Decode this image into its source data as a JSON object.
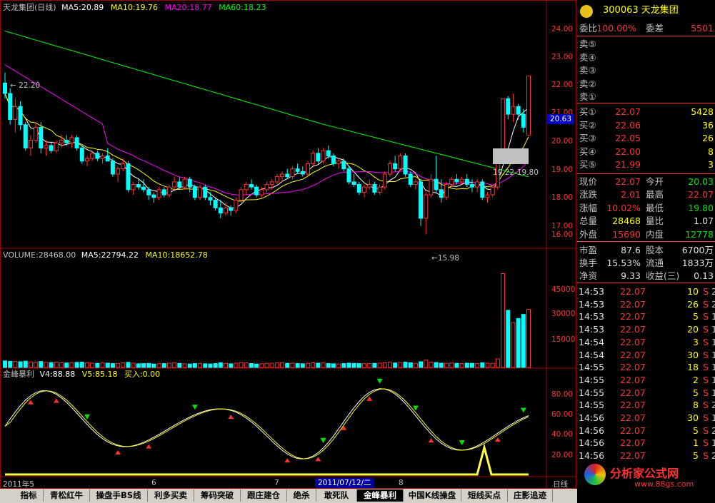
{
  "header_main": {
    "name": "天龙集团(日线)",
    "ma5": "MA5:20.89",
    "ma10": "MA10:19.76",
    "ma20": "MA20:18.77",
    "ma60": "MA60:18.23"
  },
  "header_volume": {
    "volume": "VOLUME:28468.00",
    "ma5": "MA5:22794.22",
    "ma10": "MA10:18652.78"
  },
  "header_indicator": {
    "name": "金峰暴利",
    "v4": "V4:88.88",
    "v5": "V5:85.18",
    "buy": "买入:0.00"
  },
  "price_axis": [
    "24.00",
    "23.00",
    "22.00",
    "21.00",
    "20.00",
    "19.00",
    "18.00",
    "17.00",
    "16.00"
  ],
  "current_price_tag": "20.63",
  "volume_axis": [
    "45000",
    "30000",
    "15000"
  ],
  "indicator_axis": [
    "80.00",
    "60.00",
    "40.00",
    "20.00"
  ],
  "annotations": {
    "high_left": "22.20",
    "low": "15.98",
    "range": "19.22-19.80"
  },
  "date_labels": [
    "2011年5",
    "6",
    "7",
    "8"
  ],
  "cursor_date": "2011/07/12/二",
  "period_label": "日线",
  "chart_data": {
    "type": "candlestick",
    "ylim": [
      15.5,
      24.5
    ],
    "series": [
      {
        "name": "MA5",
        "color": "#ffffff"
      },
      {
        "name": "MA10",
        "color": "#ffff00"
      },
      {
        "name": "MA20",
        "color": "#ff00ff"
      },
      {
        "name": "MA60",
        "color": "#00ff00"
      }
    ],
    "candles": [
      [
        21.8,
        22.2,
        21.2,
        21.4
      ],
      [
        21.4,
        21.6,
        20.2,
        20.4
      ],
      [
        20.4,
        21.2,
        19.9,
        20.9
      ],
      [
        20.9,
        21.1,
        20.0,
        20.2
      ],
      [
        20.2,
        20.3,
        19.2,
        19.3
      ],
      [
        19.3,
        19.8,
        19.0,
        19.6
      ],
      [
        19.6,
        20.3,
        19.5,
        20.1
      ],
      [
        20.1,
        20.3,
        19.1,
        19.3
      ],
      [
        19.3,
        19.6,
        19.0,
        19.4
      ],
      [
        19.4,
        19.5,
        19.1,
        19.2
      ],
      [
        19.2,
        19.6,
        19.1,
        19.5
      ],
      [
        19.5,
        19.8,
        19.3,
        19.6
      ],
      [
        19.6,
        19.8,
        19.4,
        19.5
      ],
      [
        19.5,
        19.8,
        19.3,
        19.7
      ],
      [
        19.7,
        19.8,
        19.2,
        19.3
      ],
      [
        19.3,
        19.4,
        18.7,
        18.8
      ],
      [
        18.8,
        19.0,
        18.6,
        18.9
      ],
      [
        18.9,
        19.2,
        18.8,
        19.1
      ],
      [
        19.1,
        19.2,
        18.8,
        18.9
      ],
      [
        18.9,
        19.1,
        18.7,
        19.0
      ],
      [
        19.0,
        19.3,
        18.8,
        18.8
      ],
      [
        18.8,
        18.9,
        18.2,
        18.3
      ],
      [
        18.3,
        18.6,
        18.0,
        18.5
      ],
      [
        18.5,
        18.9,
        18.4,
        18.7
      ],
      [
        18.7,
        18.8,
        17.6,
        17.7
      ],
      [
        17.7,
        18.0,
        17.5,
        17.9
      ],
      [
        17.9,
        18.1,
        17.7,
        17.8
      ],
      [
        17.8,
        18.1,
        17.6,
        17.7
      ],
      [
        17.7,
        17.8,
        17.3,
        17.5
      ],
      [
        17.5,
        17.6,
        17.2,
        17.4
      ],
      [
        17.4,
        17.8,
        17.3,
        17.7
      ],
      [
        17.7,
        17.8,
        17.4,
        17.5
      ],
      [
        17.5,
        17.9,
        17.4,
        17.8
      ],
      [
        17.8,
        18.2,
        17.7,
        18.0
      ],
      [
        18.0,
        18.2,
        17.7,
        17.8
      ],
      [
        17.8,
        18.2,
        17.7,
        18.1
      ],
      [
        18.1,
        18.2,
        17.6,
        17.8
      ],
      [
        17.8,
        17.9,
        17.3,
        17.4
      ],
      [
        17.4,
        17.9,
        17.3,
        17.8
      ],
      [
        17.8,
        17.9,
        17.3,
        17.4
      ],
      [
        17.4,
        17.6,
        17.1,
        17.3
      ],
      [
        17.3,
        17.4,
        16.9,
        17.0
      ],
      [
        17.0,
        17.3,
        16.6,
        16.8
      ],
      [
        16.8,
        17.2,
        16.7,
        17.0
      ],
      [
        17.0,
        17.1,
        16.7,
        16.9
      ],
      [
        16.9,
        17.4,
        16.8,
        17.3
      ],
      [
        17.3,
        17.8,
        17.2,
        17.7
      ],
      [
        17.7,
        18.0,
        17.5,
        17.9
      ],
      [
        17.9,
        18.1,
        17.7,
        17.8
      ],
      [
        17.8,
        17.9,
        17.4,
        17.5
      ],
      [
        17.5,
        17.8,
        17.4,
        17.7
      ],
      [
        17.7,
        18.0,
        17.6,
        17.9
      ],
      [
        17.9,
        18.1,
        17.7,
        18.0
      ],
      [
        18.0,
        18.3,
        17.9,
        18.2
      ],
      [
        18.2,
        18.4,
        18.0,
        18.3
      ],
      [
        18.3,
        18.5,
        18.1,
        18.2
      ],
      [
        18.2,
        18.6,
        18.1,
        18.5
      ],
      [
        18.5,
        18.7,
        18.3,
        18.4
      ],
      [
        18.4,
        18.6,
        18.2,
        18.3
      ],
      [
        18.3,
        18.8,
        18.2,
        18.7
      ],
      [
        18.7,
        19.2,
        18.6,
        19.1
      ],
      [
        19.1,
        19.3,
        18.7,
        18.8
      ],
      [
        18.8,
        19.3,
        18.7,
        19.2
      ],
      [
        19.2,
        19.4,
        18.9,
        19.0
      ],
      [
        19.0,
        19.1,
        18.6,
        18.7
      ],
      [
        18.7,
        18.9,
        18.5,
        18.8
      ],
      [
        18.8,
        18.9,
        18.4,
        18.5
      ],
      [
        18.5,
        18.6,
        17.9,
        18.0
      ],
      [
        18.0,
        18.3,
        17.8,
        17.9
      ],
      [
        17.9,
        18.0,
        17.5,
        17.6
      ],
      [
        17.6,
        17.9,
        17.4,
        17.8
      ],
      [
        17.8,
        18.1,
        17.7,
        17.9
      ],
      [
        17.9,
        18.0,
        17.5,
        17.6
      ],
      [
        17.6,
        17.9,
        17.5,
        17.8
      ],
      [
        17.8,
        18.4,
        17.7,
        18.3
      ],
      [
        18.3,
        18.8,
        18.2,
        18.7
      ],
      [
        18.7,
        19.0,
        18.4,
        18.5
      ],
      [
        18.5,
        19.1,
        18.4,
        19.0
      ],
      [
        19.0,
        19.1,
        18.2,
        18.3
      ],
      [
        18.3,
        18.4,
        17.8,
        17.9
      ],
      [
        17.9,
        18.1,
        17.7,
        18.0
      ],
      [
        18.0,
        18.1,
        16.3,
        16.6
      ],
      [
        16.6,
        17.6,
        15.98,
        17.5
      ],
      [
        17.5,
        18.3,
        17.4,
        18.1
      ],
      [
        18.1,
        19.0,
        17.6,
        17.7
      ],
      [
        17.7,
        18.1,
        17.2,
        17.4
      ],
      [
        17.4,
        18.0,
        17.3,
        17.9
      ],
      [
        17.9,
        18.2,
        17.8,
        18.1
      ],
      [
        18.1,
        18.3,
        17.9,
        18.0
      ],
      [
        18.0,
        18.2,
        17.9,
        18.1
      ],
      [
        18.1,
        18.3,
        17.8,
        17.9
      ],
      [
        17.9,
        18.1,
        17.6,
        17.8
      ],
      [
        17.8,
        18.1,
        17.6,
        18.0
      ],
      [
        18.0,
        18.1,
        17.3,
        17.4
      ],
      [
        17.4,
        17.6,
        17.2,
        17.5
      ],
      [
        17.5,
        17.9,
        17.4,
        17.8
      ],
      [
        17.8,
        19.22,
        17.7,
        19.22
      ],
      [
        19.22,
        21.2,
        19.22,
        21.2
      ],
      [
        21.2,
        21.3,
        20.4,
        20.6
      ],
      [
        20.6,
        21.4,
        20.3,
        20.9
      ],
      [
        20.9,
        21.0,
        20.4,
        20.6
      ],
      [
        20.6,
        20.8,
        19.9,
        20.1
      ],
      [
        19.8,
        22.07,
        19.8,
        22.07
      ]
    ],
    "volume": [
      3200,
      3000,
      2900,
      2800,
      3100,
      2700,
      2600,
      2900,
      2500,
      2400,
      2600,
      2300,
      2200,
      2400,
      2500,
      2600,
      2300,
      2100,
      2000,
      2200,
      2100,
      1900,
      2000,
      2300,
      2500,
      2100,
      1800,
      1900,
      2000,
      1700,
      1800,
      1900,
      2100,
      2200,
      2000,
      1800,
      1700,
      1900,
      2000,
      1800,
      1700,
      1900,
      2300,
      2000,
      1800,
      2100,
      2400,
      2200,
      1900,
      1700,
      1800,
      2000,
      2100,
      2200,
      2300,
      2000,
      2100,
      1900,
      1800,
      2000,
      2300,
      2100,
      2200,
      1900,
      1800,
      1700,
      1900,
      2100,
      2000,
      1900,
      1800,
      1900,
      2000,
      2100,
      2300,
      2500,
      2200,
      2400,
      2600,
      2300,
      2000,
      2800,
      3600,
      2600,
      2400,
      2100,
      2000,
      2200,
      2000,
      1900,
      2100,
      2000,
      1900,
      2300,
      2100,
      2000,
      4200,
      46000,
      28000,
      22000,
      24000,
      26000,
      28468
    ],
    "indicator_markers": {
      "green_down": [
        16,
        37,
        62,
        62,
        73,
        80,
        89,
        101
      ],
      "red_up": [
        5,
        10,
        22,
        28,
        44,
        55,
        61,
        66,
        71,
        83,
        96,
        104,
        107
      ]
    }
  },
  "order_book": {
    "title": "300063 天龙集团",
    "ratio_label": "委比",
    "ratio_value": "100.00%",
    "diff_label": "委差",
    "diff_value": "5501",
    "sells": [
      {
        "label": "卖⑤",
        "price": "",
        "vol": ""
      },
      {
        "label": "卖④",
        "price": "",
        "vol": ""
      },
      {
        "label": "卖③",
        "price": "",
        "vol": ""
      },
      {
        "label": "卖②",
        "price": "",
        "vol": ""
      },
      {
        "label": "卖①",
        "price": "",
        "vol": ""
      }
    ],
    "buys": [
      {
        "label": "买①",
        "price": "22.07",
        "vol": "5428"
      },
      {
        "label": "买②",
        "price": "22.06",
        "vol": "36"
      },
      {
        "label": "买③",
        "price": "22.05",
        "vol": "26"
      },
      {
        "label": "买④",
        "price": "22.00",
        "vol": "8"
      },
      {
        "label": "买⑤",
        "price": "21.99",
        "vol": "3"
      }
    ]
  },
  "quote": [
    {
      "l1": "现价",
      "v1": "22.07",
      "c1": "red",
      "l2": "今开",
      "v2": "20.03",
      "c2": "grn"
    },
    {
      "l1": "涨跌",
      "v1": "2.01",
      "c1": "red",
      "l2": "最高",
      "v2": "22.07",
      "c2": "red"
    },
    {
      "l1": "涨幅",
      "v1": "10.02%",
      "c1": "red",
      "l2": "最低",
      "v2": "19.80",
      "c2": "grn"
    },
    {
      "l1": "总量",
      "v1": "28468",
      "c1": "yel",
      "l2": "量比",
      "v2": "1.07",
      "c2": "wht"
    },
    {
      "l1": "外盘",
      "v1": "15690",
      "c1": "red",
      "l2": "内盘",
      "v2": "12778",
      "c2": "grn"
    }
  ],
  "fundamentals": [
    {
      "l1": "市盈",
      "v1": "87.6",
      "l2": "股本",
      "v2": "6700万"
    },
    {
      "l1": "换手",
      "v1": "15.53%",
      "l2": "流通",
      "v2": "1833万"
    },
    {
      "l1": "净资",
      "v1": "9.33",
      "l2": "收益(三)",
      "v2": "0.13"
    }
  ],
  "ticks": [
    {
      "time": "14:53",
      "price": "22.07",
      "vol": "10",
      "side": "S",
      "n": "2"
    },
    {
      "time": "14:53",
      "price": "22.07",
      "vol": "26",
      "side": "S",
      "n": "2"
    },
    {
      "time": "14:53",
      "price": "22.07",
      "vol": "5",
      "side": "S",
      "n": "1"
    },
    {
      "time": "14:53",
      "price": "22.07",
      "vol": "20",
      "side": "S",
      "n": "1"
    },
    {
      "time": "14:54",
      "price": "22.07",
      "vol": "3",
      "side": "S",
      "n": "1"
    },
    {
      "time": "14:54",
      "price": "22.07",
      "vol": "30",
      "side": "S",
      "n": "1"
    },
    {
      "time": "14:55",
      "price": "22.07",
      "vol": "18",
      "side": "S",
      "n": "1"
    },
    {
      "time": "14:55",
      "price": "22.07",
      "vol": "2",
      "side": "S",
      "n": "1"
    },
    {
      "time": "14:55",
      "price": "22.07",
      "vol": "5",
      "side": "S",
      "n": "1"
    },
    {
      "time": "14:55",
      "price": "22.07",
      "vol": "8",
      "side": "S",
      "n": "2"
    },
    {
      "time": "14:56",
      "price": "22.07",
      "vol": "30",
      "side": "S",
      "n": "1"
    },
    {
      "time": "14:56",
      "price": "22.07",
      "vol": "5",
      "side": "S",
      "n": "2"
    },
    {
      "time": "14:56",
      "price": "22.07",
      "vol": "1",
      "side": "S",
      "n": "1"
    },
    {
      "time": "14:56",
      "price": "22.07",
      "vol": "5",
      "side": "S",
      "n": "2"
    }
  ],
  "watermark": {
    "brand": "分析家公式网",
    "url": "www.88gs.com"
  },
  "tabs": [
    "指标",
    "青松红牛",
    "操盘手BS线",
    "利多买卖",
    "筹码突破",
    "跟庄建仓",
    "绝杀",
    "敢死队",
    "金峰暴利",
    "中国K线操盘",
    "短线买点",
    "庄影追迹"
  ],
  "active_tab": "金峰暴利",
  "colors": {
    "up": "#ff3232",
    "down": "#00ffff",
    "axis": "#ff3232",
    "bg": "#000000"
  }
}
